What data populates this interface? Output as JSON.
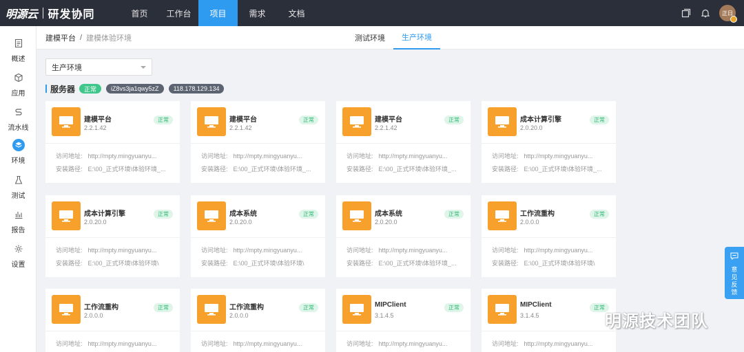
{
  "header": {
    "logo_text": "明源云",
    "app_name": "研发协同",
    "nav": [
      {
        "label": "首页"
      },
      {
        "label": "工作台"
      },
      {
        "label": "项目",
        "active": true
      },
      {
        "label": "需求"
      },
      {
        "label": "文档"
      }
    ],
    "avatar_text": "正日"
  },
  "sidebar": {
    "items": [
      {
        "label": "概述",
        "icon": "document-icon"
      },
      {
        "label": "应用",
        "icon": "cube-icon"
      },
      {
        "label": "流水线",
        "icon": "pipeline-icon"
      },
      {
        "label": "环境",
        "icon": "layers-icon",
        "active": true
      },
      {
        "label": "测试",
        "icon": "flask-icon"
      },
      {
        "label": "报告",
        "icon": "bar-chart-icon"
      },
      {
        "label": "设置",
        "icon": "gear-icon"
      }
    ]
  },
  "breadcrumb": {
    "parent": "建模平台",
    "separator": "/",
    "current": "建模体验环境"
  },
  "env_tabs": [
    {
      "label": "测试环境"
    },
    {
      "label": "生产环境",
      "active": true
    }
  ],
  "env_select": {
    "value": "生产环境"
  },
  "server": {
    "label": "服务器",
    "status": "正常",
    "host": "iZ8vs3ja1qwy5zZ",
    "ip": "118.178.129.134"
  },
  "card_labels": {
    "url_key": "访问地址:",
    "path_key": "安装路径:"
  },
  "cards": [
    {
      "name": "建模平台",
      "version": "2.2.1.42",
      "status": "正常",
      "url": "http://mpty.mingyuanyu...",
      "path": "E:\\00_正式环境\\体验环境_..."
    },
    {
      "name": "建模平台",
      "version": "2.2.1.42",
      "status": "正常",
      "url": "http://mpty.mingyuanyu...",
      "path": "E:\\00_正式环境\\体验环境_..."
    },
    {
      "name": "建模平台",
      "version": "2.2.1.42",
      "status": "正常",
      "url": "http://mpty.mingyuanyu...",
      "path": "E:\\00_正式环境\\体验环境_..."
    },
    {
      "name": "成本计算引擎",
      "version": "2.0.20.0",
      "status": "正常",
      "url": "http://mpty.mingyuanyu...",
      "path": "E:\\00_正式环境\\体验环境_..."
    },
    {
      "name": "成本计算引擎",
      "version": "2.0.20.0",
      "status": "正常",
      "url": "http://mpty.mingyuanyu...",
      "path": "E:\\00_正式环境\\体验环境\\"
    },
    {
      "name": "成本系统",
      "version": "2.0.20.0",
      "status": "正常",
      "url": "http://mpty.mingyuanyu...",
      "path": "E:\\00_正式环境\\体验环境\\"
    },
    {
      "name": "成本系统",
      "version": "2.0.20.0",
      "status": "正常",
      "url": "http://mpty.mingyuanyu...",
      "path": "E:\\00_正式环境\\体验环境_..."
    },
    {
      "name": "工作流重构",
      "version": "2.0.0.0",
      "status": "正常",
      "url": "http://mpty.mingyuanyu...",
      "path": "E:\\00_正式环境\\体验环境\\"
    },
    {
      "name": "工作流重构",
      "version": "2.0.0.0",
      "status": "正常",
      "url": "http://mpty.mingyuanyu...",
      "path": ""
    },
    {
      "name": "工作流重构",
      "version": "2.0.0.0",
      "status": "正常",
      "url": "http://mpty.mingyuanyu...",
      "path": ""
    },
    {
      "name": "MIPClient",
      "version": "3.1.4.5",
      "status": "正常",
      "url": "http://mpty.mingyuanyu...",
      "path": ""
    },
    {
      "name": "MIPClient",
      "version": "3.1.4.5",
      "status": "正常",
      "url": "http://mpty.mingyuanyu...",
      "path": ""
    }
  ],
  "feedback": {
    "label": "意见反馈"
  },
  "watermark": {
    "text": "明源技术团队"
  },
  "colors": {
    "accent": "#2f9bf0",
    "topbar": "#2b2f3a",
    "card_icon": "#f7a02c",
    "ok": "#3fc68a"
  }
}
